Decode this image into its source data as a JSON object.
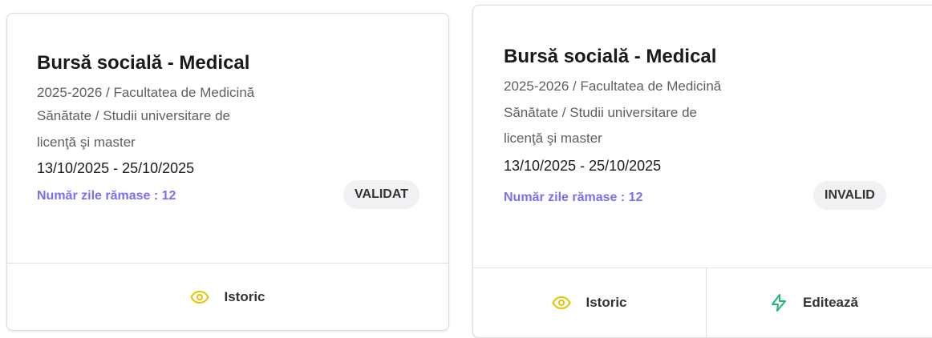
{
  "cards": [
    {
      "title": "Bursă socială - Medical",
      "line1": "2025-2026 / Facultatea de Medicină",
      "line2": "Sănătate / Studii universitare de",
      "line3": "licenţă şi master",
      "dates": "13/10/2025 - 25/10/2025",
      "days_remaining": "Număr zile rămase : 12",
      "status": "VALIDAT",
      "actions": [
        {
          "label": "Istoric",
          "icon": "eye-icon",
          "color": "#e8c200"
        }
      ]
    },
    {
      "title": "Bursă socială - Medical",
      "line1": "2025-2026 / Facultatea de Medicină",
      "line2": "Sănătate / Studii universitare de",
      "line3": "licenţă şi master",
      "dates": "13/10/2025 - 25/10/2025",
      "days_remaining": "Număr zile rămase : 12",
      "status": "INVALID",
      "actions": [
        {
          "label": "Istoric",
          "icon": "eye-icon",
          "color": "#e8c200"
        },
        {
          "label": "Editează",
          "icon": "lightning-icon",
          "color": "#22b573"
        }
      ]
    }
  ],
  "colors": {
    "accent": "#7b6ef6",
    "badge_bg": "#f1f1f3"
  }
}
